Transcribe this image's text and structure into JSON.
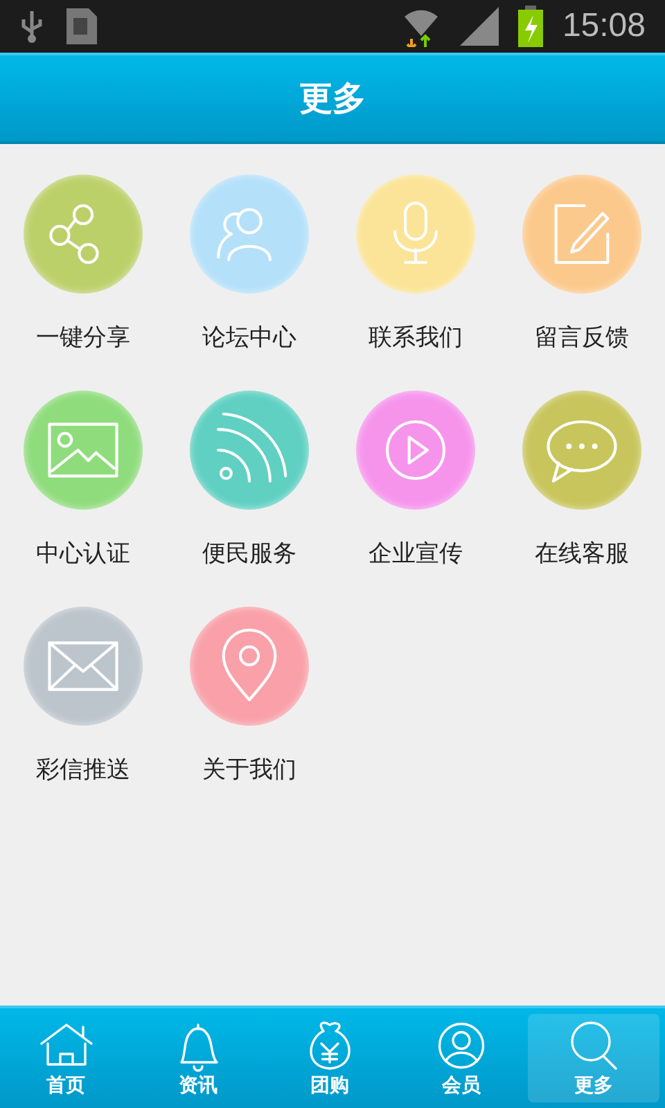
{
  "status_bar": {
    "time": "15:08"
  },
  "header": {
    "title": "更多"
  },
  "items": [
    {
      "label": "一键分享",
      "kind": "share",
      "color": "#bcd06a"
    },
    {
      "label": "论坛中心",
      "kind": "people",
      "color": "#b4e0fa"
    },
    {
      "label": "联系我们",
      "kind": "mic",
      "color": "#fbe497"
    },
    {
      "label": "留言反馈",
      "kind": "edit",
      "color": "#fcc98c"
    },
    {
      "label": "中心认证",
      "kind": "image",
      "color": "#8fdc7c"
    },
    {
      "label": "便民服务",
      "kind": "feed",
      "color": "#5fd0c2"
    },
    {
      "label": "企业宣传",
      "kind": "play",
      "color": "#f694ec"
    },
    {
      "label": "在线客服",
      "kind": "chat",
      "color": "#c8c55c"
    },
    {
      "label": "彩信推送",
      "kind": "mail",
      "color": "#bcc4cc"
    },
    {
      "label": "关于我们",
      "kind": "pin",
      "color": "#f9a0a8"
    }
  ],
  "tabs": [
    {
      "label": "首页",
      "kind": "home",
      "selected": false
    },
    {
      "label": "资讯",
      "kind": "bell",
      "selected": false
    },
    {
      "label": "团购",
      "kind": "money",
      "selected": false
    },
    {
      "label": "会员",
      "kind": "user",
      "selected": false
    },
    {
      "label": "更多",
      "kind": "search",
      "selected": true
    }
  ]
}
